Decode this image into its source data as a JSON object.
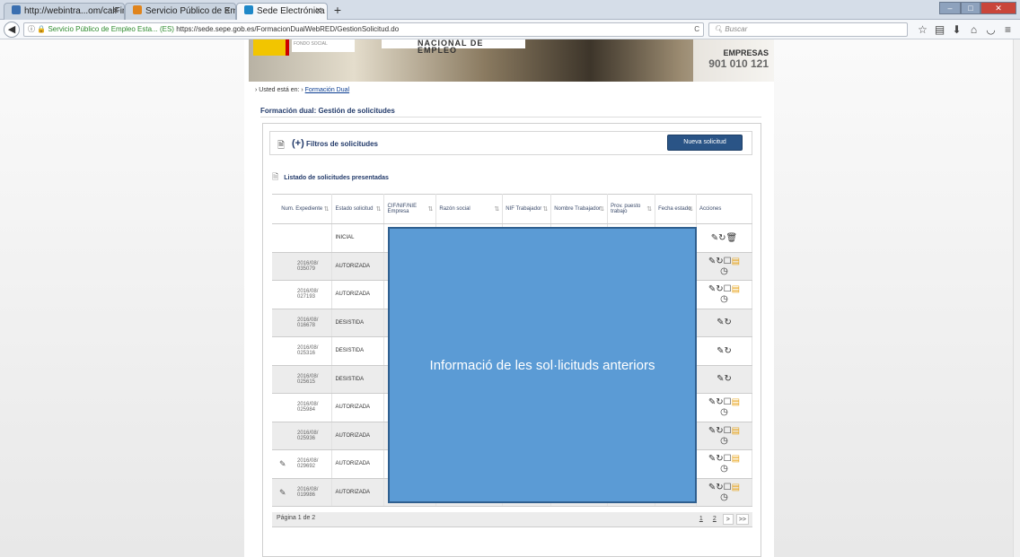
{
  "browser": {
    "tabs": [
      {
        "label": "http://webintra...om/calFins.php",
        "fav": "#3a6fb0"
      },
      {
        "label": "Servicio Público de Empleo...",
        "fav": "#e0841c"
      },
      {
        "label": "Sede Electrónica del SEPE. ...",
        "fav": "#1e88c8"
      }
    ],
    "new_tab": "+",
    "url_secure_label": "Servicio Público de Empleo Esta... (ES)",
    "url": "https://sede.sepe.gob.es/FormacionDualWebRED/GestionSolicitud.do",
    "search_placeholder": "Buscar"
  },
  "banner": {
    "logo_text": "FONDO SOCIAL",
    "sepe_text": "NACIONAL DE EMPLEO",
    "empresas": "EMPRESAS",
    "phone": "901 010 121"
  },
  "breadcrumb": {
    "prefix": "Usted está en:",
    "link": "Formación Dual"
  },
  "page_title": "Formación dual: Gestión de solicitudes",
  "filters": {
    "plus": "(+)",
    "label": "Filtros de solicitudes"
  },
  "new_request": "Nueva solicitud",
  "list_title": "Listado de solicitudes presentadas",
  "table": {
    "headers": [
      "Num. Expediente",
      "Estado solicitud",
      "CIF/NIF/NIE Empresa",
      "Razón social",
      "NIF Trabajador",
      "Nombre Trabajador",
      "Prov. puesto trabajo",
      "Fecha estado",
      "Acciones"
    ],
    "rows": [
      {
        "num": "",
        "estado": "INICIAL",
        "edit": false,
        "actions": "✎ ↻ 🗑",
        "clock": false,
        "doc": false
      },
      {
        "num": "2016/08/ 035079",
        "estado": "AUTORIZADA",
        "edit": false,
        "actions": "✎ ↻ ☐",
        "clock": true,
        "doc": true
      },
      {
        "num": "2016/08/ 027193",
        "estado": "AUTORIZADA",
        "edit": false,
        "actions": "✎ ↻ ☐",
        "clock": true,
        "doc": true
      },
      {
        "num": "2016/08/ 016678",
        "estado": "DESISTIDA",
        "edit": false,
        "actions": "✎ ↻",
        "clock": false,
        "doc": false
      },
      {
        "num": "2016/08/ 025316",
        "estado": "DESISTIDA",
        "edit": false,
        "actions": "✎ ↻",
        "clock": false,
        "doc": false
      },
      {
        "num": "2016/08/ 025615",
        "estado": "DESISTIDA",
        "edit": false,
        "actions": "✎ ↻",
        "clock": false,
        "doc": false
      },
      {
        "num": "2016/08/ 025984",
        "estado": "AUTORIZADA",
        "edit": false,
        "actions": "✎ ↻ ☐",
        "clock": true,
        "doc": true
      },
      {
        "num": "2016/08/ 025936",
        "estado": "AUTORIZADA",
        "edit": false,
        "actions": "✎ ↻ ☐",
        "clock": true,
        "doc": true
      },
      {
        "num": "2016/08/ 029692",
        "estado": "AUTORIZADA",
        "edit": true,
        "actions": "✎ ↻ ☐",
        "clock": true,
        "doc": true
      },
      {
        "num": "2016/08/ 019986",
        "estado": "AUTORIZADA",
        "edit": true,
        "actions": "✎ ↻ ☐",
        "clock": true,
        "doc": true
      }
    ]
  },
  "pager": {
    "info": "Página 1 de 2",
    "pages": [
      "1",
      "2"
    ],
    "next": ">",
    "last": ">>"
  },
  "overlay_text": "Informació de les sol·licituds anteriors"
}
